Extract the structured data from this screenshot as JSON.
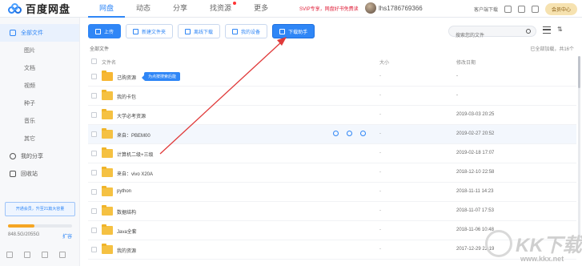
{
  "app": {
    "logo_text": "百度网盘"
  },
  "nav": [
    {
      "label": "网盘",
      "active": true
    },
    {
      "label": "动态"
    },
    {
      "label": "分享"
    },
    {
      "label": "找资源"
    },
    {
      "label": "更多"
    }
  ],
  "promo": "SVIP专享，网盘好书免费读",
  "user": {
    "name": "lhs1786769366"
  },
  "top_right": {
    "client_download": "客户端下载",
    "vip_button": "会员中心"
  },
  "sidebar": {
    "items": [
      {
        "label": "全部文件"
      },
      {
        "label": "图片"
      },
      {
        "label": "文档"
      },
      {
        "label": "视频"
      },
      {
        "label": "种子"
      },
      {
        "label": "音乐"
      },
      {
        "label": "其它"
      },
      {
        "label": "我的分享"
      },
      {
        "label": "回收站"
      }
    ],
    "quota_banner": "开通会员，升至21篇大容量",
    "storage_text": "848.5G/2055G",
    "storage_fraction": 0.41,
    "expand_label": "扩容"
  },
  "toolbar": {
    "upload": "上传",
    "new_folder": "新建文件夹",
    "offline_download": "离线下载",
    "my_devices": "我的设备",
    "download_helper": "下载助手"
  },
  "search": {
    "placeholder": "搜索您的文件"
  },
  "breadcrumb": "全部文件",
  "loaded_text": "已全部加载，共16个",
  "table": {
    "headers": {
      "name": "文件名",
      "size": "大小",
      "date": "修改日期"
    },
    "tooltip": "为点按搜索后能",
    "rows": [
      {
        "name": "己购资源",
        "size": "-",
        "date": "-"
      },
      {
        "name": "我的卡包",
        "size": "-",
        "date": "-"
      },
      {
        "name": "大学必考资源",
        "size": "-",
        "date": "2019-03-03 20:25"
      },
      {
        "name": "来自：PBEM00",
        "size": "-",
        "date": "2019-02-27 20:52"
      },
      {
        "name": "计算机二级+三级",
        "size": "-",
        "date": "2019-02-18 17:07"
      },
      {
        "name": "来自：vivo X20A",
        "size": "-",
        "date": "2018-12-10 22:58"
      },
      {
        "name": "python",
        "size": "-",
        "date": "2018-11-11 14:23"
      },
      {
        "name": "数据结构",
        "size": "-",
        "date": "2018-11-07 17:53"
      },
      {
        "name": "Java全套",
        "size": "-",
        "date": "2018-11-06 10:48"
      },
      {
        "name": "我的资源",
        "size": "-",
        "date": "2017-12-29 22:19"
      }
    ]
  },
  "watermark": {
    "text": "KK下载",
    "url": "www.kkx.net"
  }
}
